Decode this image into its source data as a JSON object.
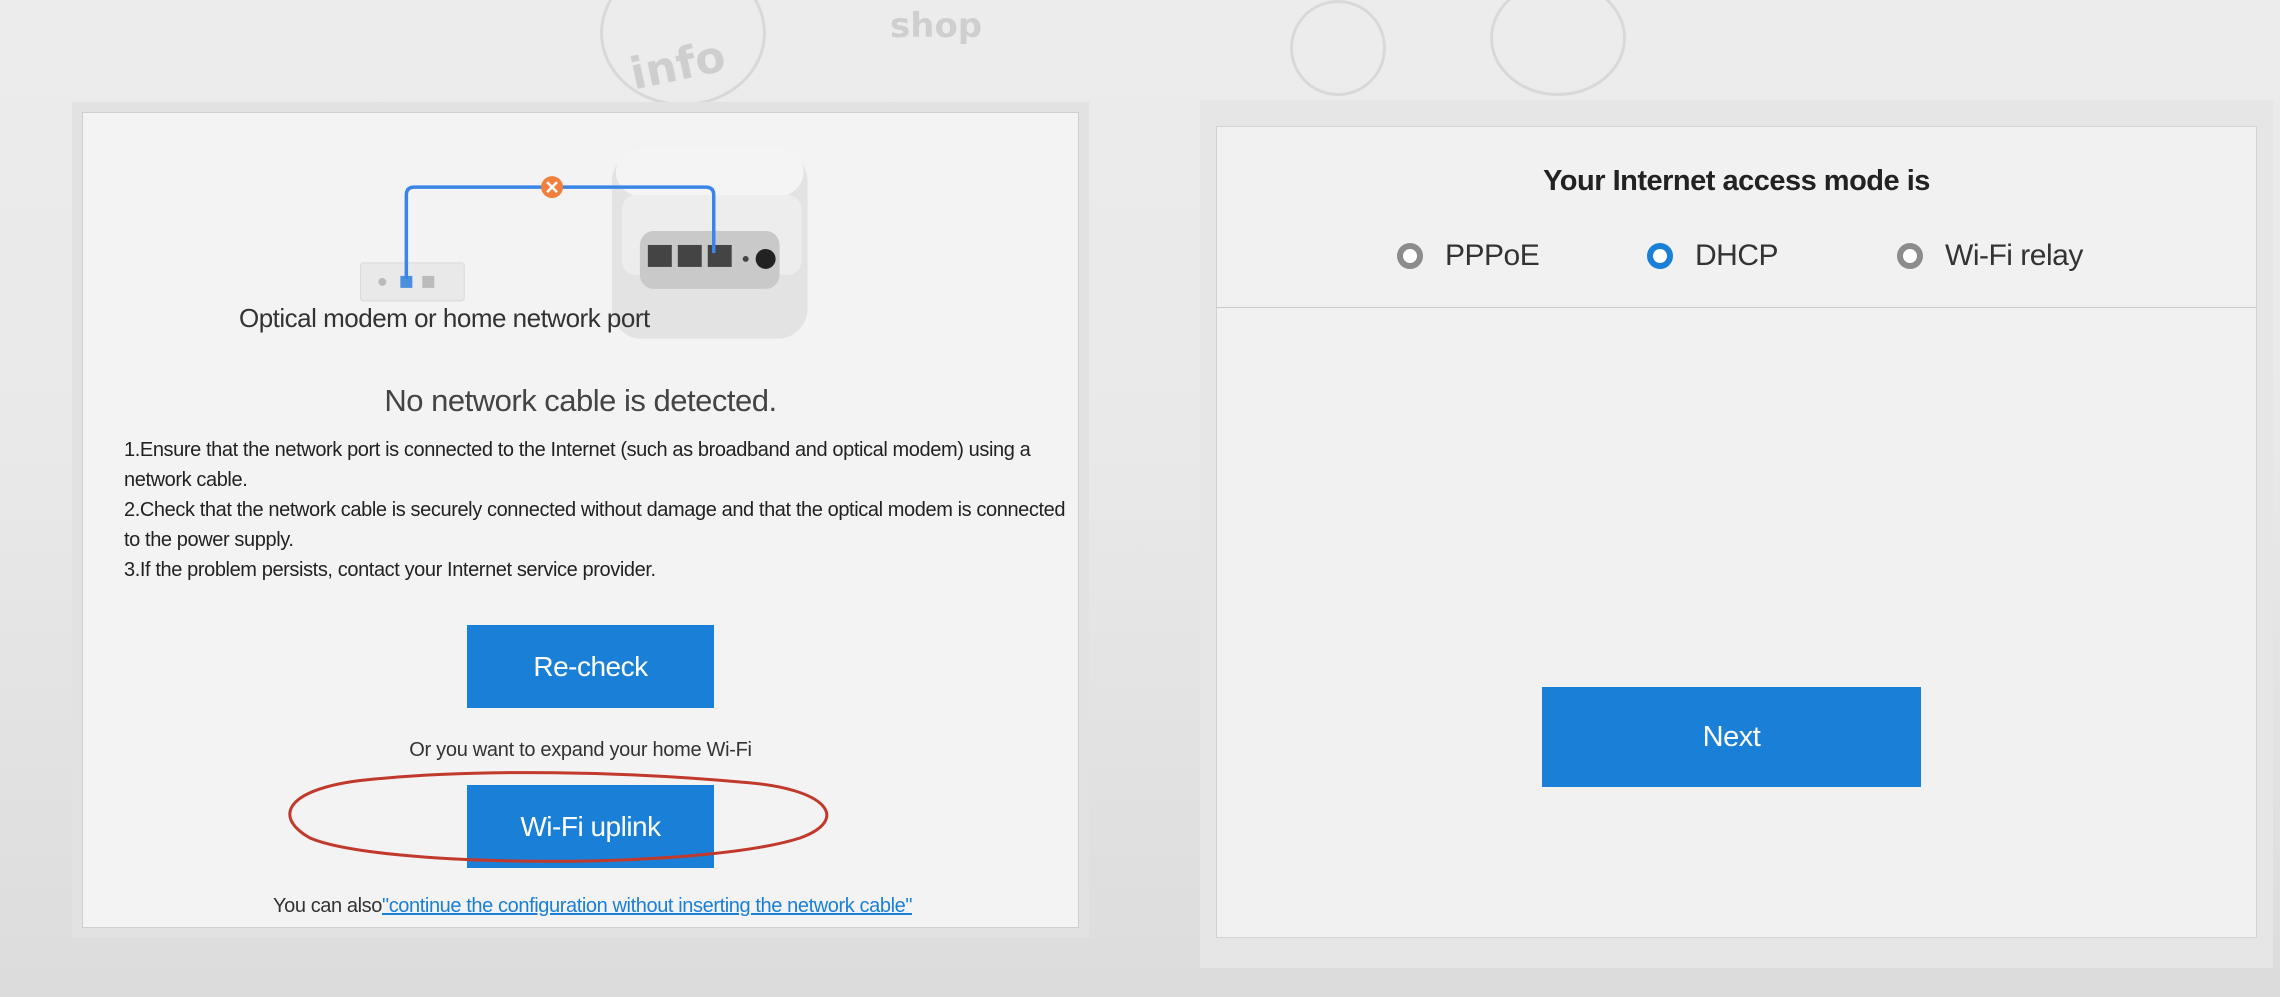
{
  "left_panel": {
    "modem_label": "Optical modem or home network port",
    "status_title": "No network cable is detected.",
    "instructions": [
      "1.Ensure that the network port is connected to the Internet (such as broadband and optical modem) using a network cable.",
      "2.Check that the network cable is securely connected without damage and that the optical modem is connected to the power supply.",
      "3.If the problem persists, contact your Internet service provider."
    ],
    "recheck_label": "Re-check",
    "expand_text": "Or you want to expand your home Wi-Fi",
    "uplink_label": "Wi-Fi uplink",
    "also_prefix": "You can also",
    "continue_link": "\"continue the configuration without inserting the network cable\""
  },
  "right_panel": {
    "title": "Your Internet access mode is",
    "options": [
      {
        "label": "PPPoE",
        "selected": false
      },
      {
        "label": "DHCP",
        "selected": true
      },
      {
        "label": "Wi-Fi relay",
        "selected": false
      }
    ],
    "next_label": "Next"
  },
  "background_doodles": [
    "info",
    "shop"
  ],
  "colors": {
    "accent": "#1a7fd6",
    "error_marker": "#f0803c",
    "annotation": "#c0392b"
  },
  "icons": [
    "router-icon",
    "disconnected-x-icon",
    "wall-port-icon"
  ]
}
